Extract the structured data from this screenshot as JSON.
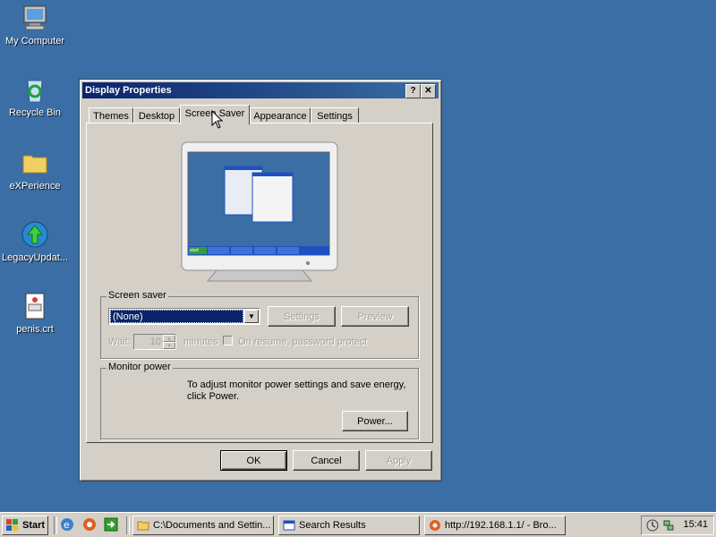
{
  "desktop": {
    "icons": [
      {
        "label": "My Computer",
        "icon": "computer-icon"
      },
      {
        "label": "Recycle Bin",
        "icon": "recycle-bin-icon"
      },
      {
        "label": "eXPerience",
        "icon": "folder-icon"
      },
      {
        "label": "LegacyUpdat...",
        "icon": "update-globe-icon"
      },
      {
        "label": "penis.crt",
        "icon": "certificate-icon"
      }
    ]
  },
  "window": {
    "title": "Display Properties",
    "help_btn": "?",
    "close_btn": "✕",
    "tabs": [
      {
        "label": "Themes",
        "active": false
      },
      {
        "label": "Desktop",
        "active": false
      },
      {
        "label": "Screen Saver",
        "active": true
      },
      {
        "label": "Appearance",
        "active": false
      },
      {
        "label": "Settings",
        "active": false
      }
    ],
    "screensaver": {
      "group_label": "Screen saver",
      "selected": "(None)",
      "settings_btn": "Settings",
      "preview_btn": "Preview",
      "wait_label": "Wait:",
      "wait_value": "10",
      "minutes_label": "minutes",
      "resume_label": "On resume, password protect"
    },
    "monitor_power": {
      "group_label": "Monitor power",
      "description": "To adjust monitor power settings and save energy, click Power.",
      "power_btn": "Power..."
    },
    "buttons": {
      "ok": "OK",
      "cancel": "Cancel",
      "apply": "Apply"
    },
    "preview": {
      "start_label": "start"
    }
  },
  "taskbar": {
    "start_label": "Start",
    "tasks": [
      {
        "label": "C:\\Documents and Settin...",
        "icon": "folder-icon"
      },
      {
        "label": "Search Results",
        "icon": "search-window-icon"
      },
      {
        "label": "http://192.168.1.1/ - Bro...",
        "icon": "browser-icon"
      }
    ],
    "clock": "15:41"
  },
  "colors": {
    "desktop": "#3a6ea5",
    "title_active": "#0a246a",
    "selection": "#0a246a"
  }
}
